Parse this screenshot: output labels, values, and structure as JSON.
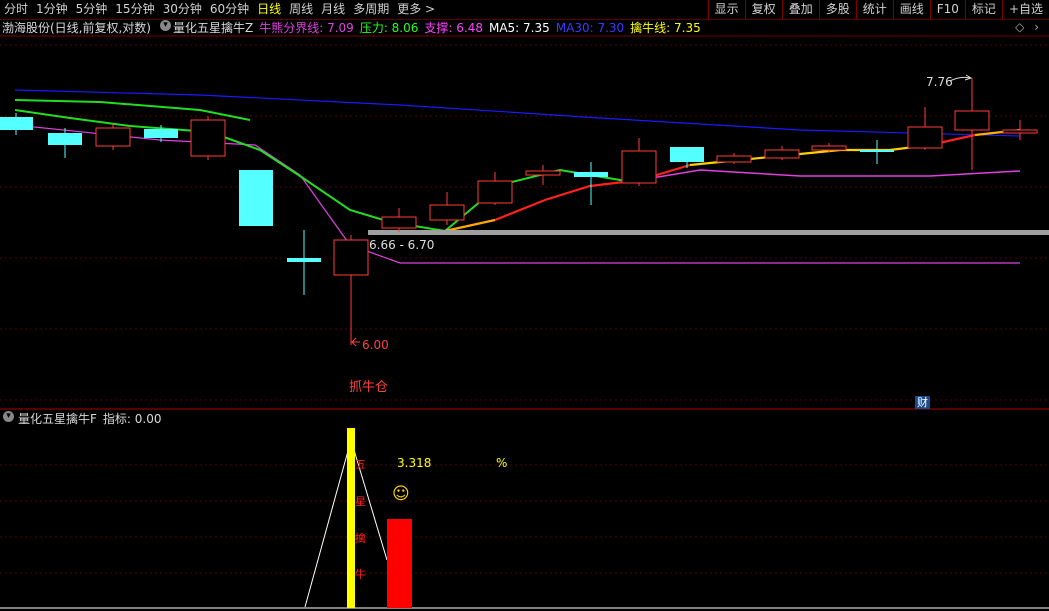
{
  "toolbar": {
    "periods": [
      "分时",
      "1分钟",
      "5分钟",
      "15分钟",
      "30分钟",
      "60分钟",
      "日线",
      "周线",
      "月线",
      "多周期",
      "更多 >"
    ],
    "active_period": "日线",
    "buttons": [
      "显示",
      "复权",
      "叠加",
      "多股",
      "统计",
      "画线",
      "F10",
      "标记",
      "+自选"
    ]
  },
  "main_info": {
    "stock": "渤海股份(日线,前复权,对数)",
    "indicator": "量化五星擒牛Z",
    "bull_bear_line": "牛熊分界线: 7.09",
    "pressure": "压力: 8.06",
    "support": "支撑: 6.48",
    "ma5": "MA5: 7.35",
    "ma30": "MA30: 7.30",
    "catch_line": "擒牛线: 7.35"
  },
  "annotations": {
    "high_label": "7.76",
    "range_label": "6.66 - 6.70",
    "low_label": "6.00",
    "buy_label": "抓牛仓",
    "cai_badge": "财"
  },
  "sub_info": {
    "indicator": "量化五星擒牛F",
    "value": "指标: 0.00"
  },
  "sub_annotations": {
    "percent_value": "3.318",
    "percent_sign": "%",
    "smile": "☺",
    "vertical_chars": [
      "五",
      "星",
      "擒",
      "牛"
    ]
  },
  "colors": {
    "up": "#ff3c3c",
    "down": "#54ffff",
    "ma_blue": "#1a1aff",
    "green_line": "#22dd22",
    "magenta": "#e040e0",
    "yellow": "#ffff00",
    "orange": "#ffb000"
  }
}
